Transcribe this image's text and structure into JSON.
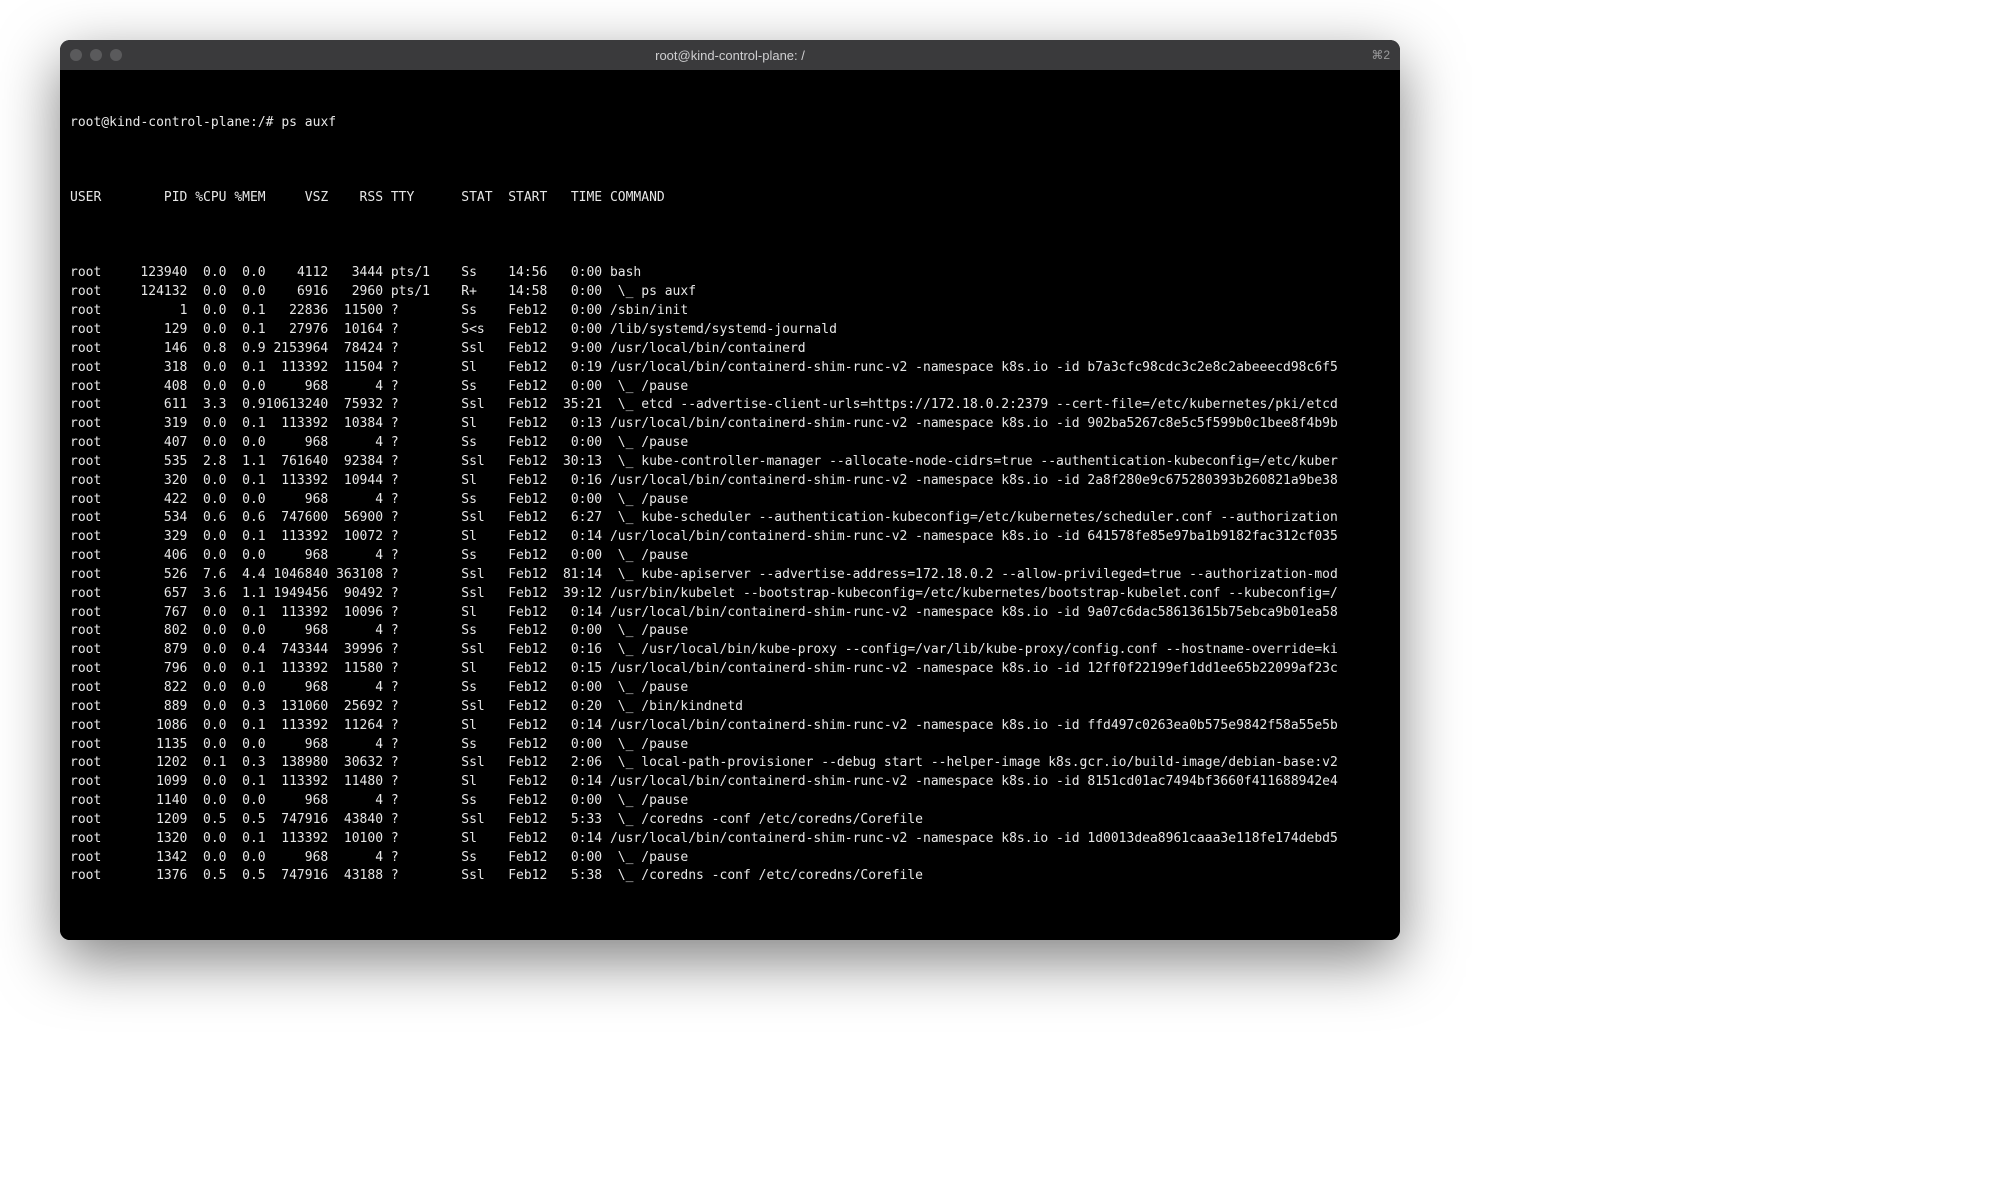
{
  "window": {
    "title": "root@kind-control-plane: /",
    "right_hint": "⌘2"
  },
  "prompt": "root@kind-control-plane:/#",
  "command": "ps auxf",
  "headers": {
    "user": "USER",
    "pid": "PID",
    "cpu": "%CPU",
    "mem": "%MEM",
    "vsz": "VSZ",
    "rss": "RSS",
    "tty": "TTY",
    "stat": "STAT",
    "start": "START",
    "time": "TIME",
    "cmd": "COMMAND"
  },
  "rows": [
    {
      "user": "root",
      "pid": "123940",
      "cpu": "0.0",
      "mem": "0.0",
      "vsz": "4112",
      "rss": "3444",
      "tty": "pts/1",
      "stat": "Ss",
      "start": "14:56",
      "time": "0:00",
      "cmd": "bash"
    },
    {
      "user": "root",
      "pid": "124132",
      "cpu": "0.0",
      "mem": "0.0",
      "vsz": "6916",
      "rss": "2960",
      "tty": "pts/1",
      "stat": "R+",
      "start": "14:58",
      "time": "0:00",
      "cmd": " \\_ ps auxf"
    },
    {
      "user": "root",
      "pid": "1",
      "cpu": "0.0",
      "mem": "0.1",
      "vsz": "22836",
      "rss": "11500",
      "tty": "?",
      "stat": "Ss",
      "start": "Feb12",
      "time": "0:00",
      "cmd": "/sbin/init"
    },
    {
      "user": "root",
      "pid": "129",
      "cpu": "0.0",
      "mem": "0.1",
      "vsz": "27976",
      "rss": "10164",
      "tty": "?",
      "stat": "S<s",
      "start": "Feb12",
      "time": "0:00",
      "cmd": "/lib/systemd/systemd-journald"
    },
    {
      "user": "root",
      "pid": "146",
      "cpu": "0.8",
      "mem": "0.9",
      "vsz": "2153964",
      "rss": "78424",
      "tty": "?",
      "stat": "Ssl",
      "start": "Feb12",
      "time": "9:00",
      "cmd": "/usr/local/bin/containerd"
    },
    {
      "user": "root",
      "pid": "318",
      "cpu": "0.0",
      "mem": "0.1",
      "vsz": "113392",
      "rss": "11504",
      "tty": "?",
      "stat": "Sl",
      "start": "Feb12",
      "time": "0:19",
      "cmd": "/usr/local/bin/containerd-shim-runc-v2 -namespace k8s.io -id b7a3cfc98cdc3c2e8c2abeeecd98c6f5"
    },
    {
      "user": "root",
      "pid": "408",
      "cpu": "0.0",
      "mem": "0.0",
      "vsz": "968",
      "rss": "4",
      "tty": "?",
      "stat": "Ss",
      "start": "Feb12",
      "time": "0:00",
      "cmd": " \\_ /pause"
    },
    {
      "user": "root",
      "pid": "611",
      "cpu": "3.3",
      "mem": "0.9",
      "vsz": "10613240",
      "rss": "75932",
      "tty": "?",
      "stat": "Ssl",
      "start": "Feb12",
      "time": "35:21",
      "cmd": " \\_ etcd --advertise-client-urls=https://172.18.0.2:2379 --cert-file=/etc/kubernetes/pki/etcd"
    },
    {
      "user": "root",
      "pid": "319",
      "cpu": "0.0",
      "mem": "0.1",
      "vsz": "113392",
      "rss": "10384",
      "tty": "?",
      "stat": "Sl",
      "start": "Feb12",
      "time": "0:13",
      "cmd": "/usr/local/bin/containerd-shim-runc-v2 -namespace k8s.io -id 902ba5267c8e5c5f599b0c1bee8f4b9b"
    },
    {
      "user": "root",
      "pid": "407",
      "cpu": "0.0",
      "mem": "0.0",
      "vsz": "968",
      "rss": "4",
      "tty": "?",
      "stat": "Ss",
      "start": "Feb12",
      "time": "0:00",
      "cmd": " \\_ /pause"
    },
    {
      "user": "root",
      "pid": "535",
      "cpu": "2.8",
      "mem": "1.1",
      "vsz": "761640",
      "rss": "92384",
      "tty": "?",
      "stat": "Ssl",
      "start": "Feb12",
      "time": "30:13",
      "cmd": " \\_ kube-controller-manager --allocate-node-cidrs=true --authentication-kubeconfig=/etc/kuber"
    },
    {
      "user": "root",
      "pid": "320",
      "cpu": "0.0",
      "mem": "0.1",
      "vsz": "113392",
      "rss": "10944",
      "tty": "?",
      "stat": "Sl",
      "start": "Feb12",
      "time": "0:16",
      "cmd": "/usr/local/bin/containerd-shim-runc-v2 -namespace k8s.io -id 2a8f280e9c675280393b260821a9be38"
    },
    {
      "user": "root",
      "pid": "422",
      "cpu": "0.0",
      "mem": "0.0",
      "vsz": "968",
      "rss": "4",
      "tty": "?",
      "stat": "Ss",
      "start": "Feb12",
      "time": "0:00",
      "cmd": " \\_ /pause"
    },
    {
      "user": "root",
      "pid": "534",
      "cpu": "0.6",
      "mem": "0.6",
      "vsz": "747600",
      "rss": "56900",
      "tty": "?",
      "stat": "Ssl",
      "start": "Feb12",
      "time": "6:27",
      "cmd": " \\_ kube-scheduler --authentication-kubeconfig=/etc/kubernetes/scheduler.conf --authorization"
    },
    {
      "user": "root",
      "pid": "329",
      "cpu": "0.0",
      "mem": "0.1",
      "vsz": "113392",
      "rss": "10072",
      "tty": "?",
      "stat": "Sl",
      "start": "Feb12",
      "time": "0:14",
      "cmd": "/usr/local/bin/containerd-shim-runc-v2 -namespace k8s.io -id 641578fe85e97ba1b9182fac312cf035"
    },
    {
      "user": "root",
      "pid": "406",
      "cpu": "0.0",
      "mem": "0.0",
      "vsz": "968",
      "rss": "4",
      "tty": "?",
      "stat": "Ss",
      "start": "Feb12",
      "time": "0:00",
      "cmd": " \\_ /pause"
    },
    {
      "user": "root",
      "pid": "526",
      "cpu": "7.6",
      "mem": "4.4",
      "vsz": "1046840",
      "rss": "363108",
      "tty": "?",
      "stat": "Ssl",
      "start": "Feb12",
      "time": "81:14",
      "cmd": " \\_ kube-apiserver --advertise-address=172.18.0.2 --allow-privileged=true --authorization-mod"
    },
    {
      "user": "root",
      "pid": "657",
      "cpu": "3.6",
      "mem": "1.1",
      "vsz": "1949456",
      "rss": "90492",
      "tty": "?",
      "stat": "Ssl",
      "start": "Feb12",
      "time": "39:12",
      "cmd": "/usr/bin/kubelet --bootstrap-kubeconfig=/etc/kubernetes/bootstrap-kubelet.conf --kubeconfig=/"
    },
    {
      "user": "root",
      "pid": "767",
      "cpu": "0.0",
      "mem": "0.1",
      "vsz": "113392",
      "rss": "10096",
      "tty": "?",
      "stat": "Sl",
      "start": "Feb12",
      "time": "0:14",
      "cmd": "/usr/local/bin/containerd-shim-runc-v2 -namespace k8s.io -id 9a07c6dac58613615b75ebca9b01ea58"
    },
    {
      "user": "root",
      "pid": "802",
      "cpu": "0.0",
      "mem": "0.0",
      "vsz": "968",
      "rss": "4",
      "tty": "?",
      "stat": "Ss",
      "start": "Feb12",
      "time": "0:00",
      "cmd": " \\_ /pause"
    },
    {
      "user": "root",
      "pid": "879",
      "cpu": "0.0",
      "mem": "0.4",
      "vsz": "743344",
      "rss": "39996",
      "tty": "?",
      "stat": "Ssl",
      "start": "Feb12",
      "time": "0:16",
      "cmd": " \\_ /usr/local/bin/kube-proxy --config=/var/lib/kube-proxy/config.conf --hostname-override=ki"
    },
    {
      "user": "root",
      "pid": "796",
      "cpu": "0.0",
      "mem": "0.1",
      "vsz": "113392",
      "rss": "11580",
      "tty": "?",
      "stat": "Sl",
      "start": "Feb12",
      "time": "0:15",
      "cmd": "/usr/local/bin/containerd-shim-runc-v2 -namespace k8s.io -id 12ff0f22199ef1dd1ee65b22099af23c"
    },
    {
      "user": "root",
      "pid": "822",
      "cpu": "0.0",
      "mem": "0.0",
      "vsz": "968",
      "rss": "4",
      "tty": "?",
      "stat": "Ss",
      "start": "Feb12",
      "time": "0:00",
      "cmd": " \\_ /pause"
    },
    {
      "user": "root",
      "pid": "889",
      "cpu": "0.0",
      "mem": "0.3",
      "vsz": "131060",
      "rss": "25692",
      "tty": "?",
      "stat": "Ssl",
      "start": "Feb12",
      "time": "0:20",
      "cmd": " \\_ /bin/kindnetd"
    },
    {
      "user": "root",
      "pid": "1086",
      "cpu": "0.0",
      "mem": "0.1",
      "vsz": "113392",
      "rss": "11264",
      "tty": "?",
      "stat": "Sl",
      "start": "Feb12",
      "time": "0:14",
      "cmd": "/usr/local/bin/containerd-shim-runc-v2 -namespace k8s.io -id ffd497c0263ea0b575e9842f58a55e5b"
    },
    {
      "user": "root",
      "pid": "1135",
      "cpu": "0.0",
      "mem": "0.0",
      "vsz": "968",
      "rss": "4",
      "tty": "?",
      "stat": "Ss",
      "start": "Feb12",
      "time": "0:00",
      "cmd": " \\_ /pause"
    },
    {
      "user": "root",
      "pid": "1202",
      "cpu": "0.1",
      "mem": "0.3",
      "vsz": "138980",
      "rss": "30632",
      "tty": "?",
      "stat": "Ssl",
      "start": "Feb12",
      "time": "2:06",
      "cmd": " \\_ local-path-provisioner --debug start --helper-image k8s.gcr.io/build-image/debian-base:v2"
    },
    {
      "user": "root",
      "pid": "1099",
      "cpu": "0.0",
      "mem": "0.1",
      "vsz": "113392",
      "rss": "11480",
      "tty": "?",
      "stat": "Sl",
      "start": "Feb12",
      "time": "0:14",
      "cmd": "/usr/local/bin/containerd-shim-runc-v2 -namespace k8s.io -id 8151cd01ac7494bf3660f411688942e4"
    },
    {
      "user": "root",
      "pid": "1140",
      "cpu": "0.0",
      "mem": "0.0",
      "vsz": "968",
      "rss": "4",
      "tty": "?",
      "stat": "Ss",
      "start": "Feb12",
      "time": "0:00",
      "cmd": " \\_ /pause"
    },
    {
      "user": "root",
      "pid": "1209",
      "cpu": "0.5",
      "mem": "0.5",
      "vsz": "747916",
      "rss": "43840",
      "tty": "?",
      "stat": "Ssl",
      "start": "Feb12",
      "time": "5:33",
      "cmd": " \\_ /coredns -conf /etc/coredns/Corefile"
    },
    {
      "user": "root",
      "pid": "1320",
      "cpu": "0.0",
      "mem": "0.1",
      "vsz": "113392",
      "rss": "10100",
      "tty": "?",
      "stat": "Sl",
      "start": "Feb12",
      "time": "0:14",
      "cmd": "/usr/local/bin/containerd-shim-runc-v2 -namespace k8s.io -id 1d0013dea8961caaa3e118fe174debd5"
    },
    {
      "user": "root",
      "pid": "1342",
      "cpu": "0.0",
      "mem": "0.0",
      "vsz": "968",
      "rss": "4",
      "tty": "?",
      "stat": "Ss",
      "start": "Feb12",
      "time": "0:00",
      "cmd": " \\_ /pause"
    },
    {
      "user": "root",
      "pid": "1376",
      "cpu": "0.5",
      "mem": "0.5",
      "vsz": "747916",
      "rss": "43188",
      "tty": "?",
      "stat": "Ssl",
      "start": "Feb12",
      "time": "5:38",
      "cmd": " \\_ /coredns -conf /etc/coredns/Corefile"
    }
  ]
}
